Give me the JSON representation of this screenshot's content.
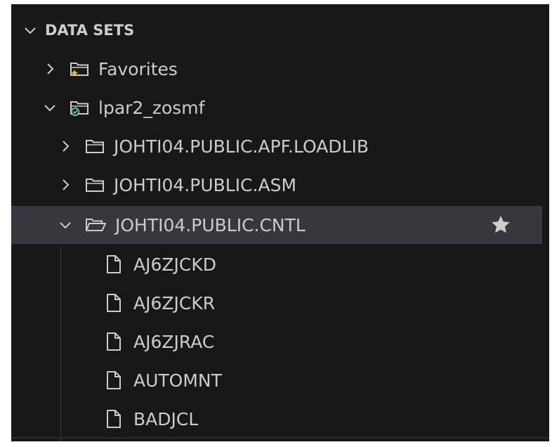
{
  "section": {
    "title": "DATA SETS"
  },
  "tree": {
    "favorites_label": "Favorites",
    "profile_label": "lpar2_zosmf",
    "datasets": [
      {
        "label": "JOHTI04.PUBLIC.APF.LOADLIB"
      },
      {
        "label": "JOHTI04.PUBLIC.ASM"
      },
      {
        "label": "JOHTI04.PUBLIC.CNTL"
      }
    ],
    "members": [
      {
        "label": "AJ6ZJCKD"
      },
      {
        "label": "AJ6ZJCKR"
      },
      {
        "label": "AJ6ZJRAC"
      },
      {
        "label": "AUTOMNT"
      },
      {
        "label": "BADJCL"
      }
    ]
  },
  "icons": {
    "favorites": "folder-star-icon",
    "profile": "folder-connected-icon",
    "dataset": "folder-icon",
    "dataset_open": "folder-open-icon",
    "member": "file-icon",
    "star": "star-icon"
  },
  "colors": {
    "background": "#181818",
    "selected_row": "#37373d",
    "text": "#cccccc",
    "favorite_star": "#e8b53c",
    "connected_badge": "#73c991"
  }
}
